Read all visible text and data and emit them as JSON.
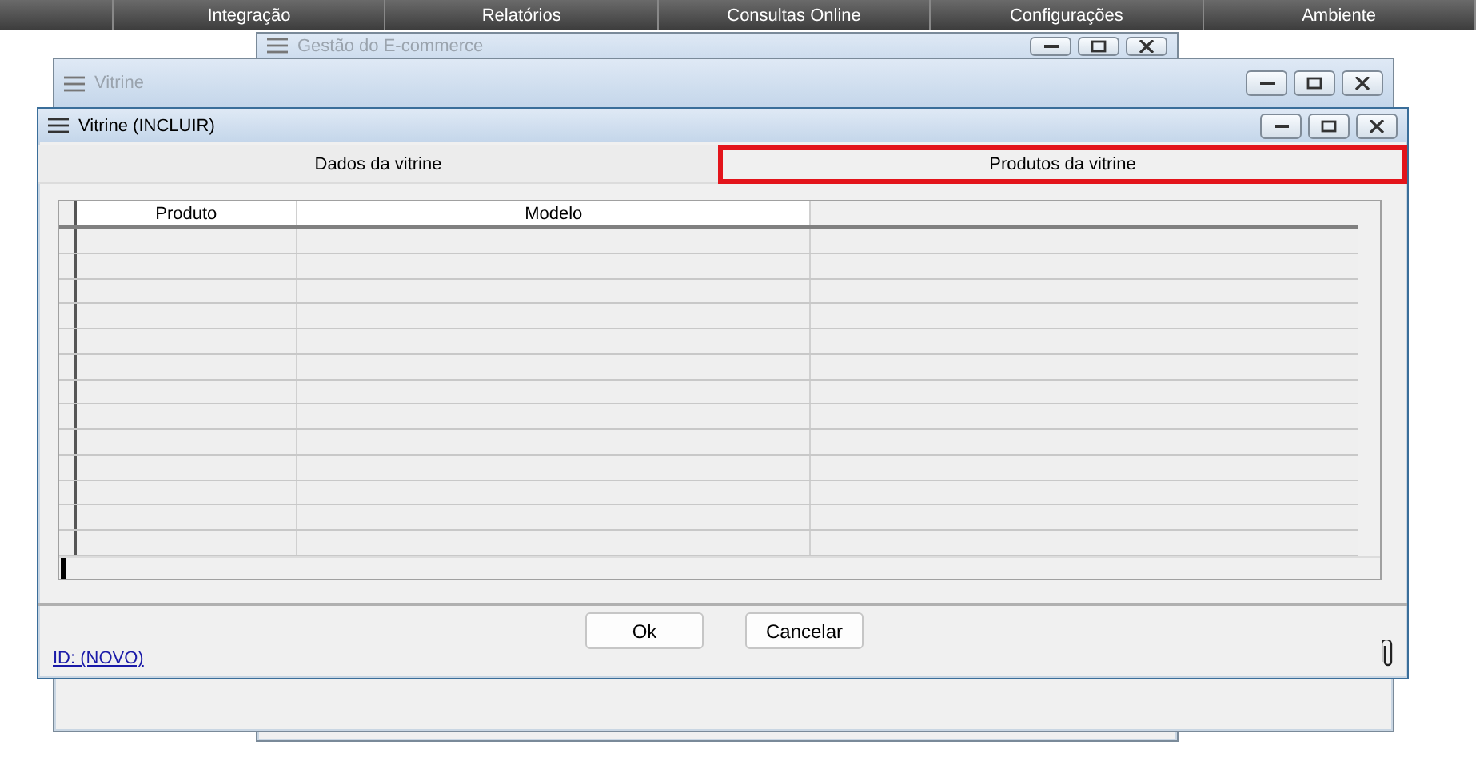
{
  "menu": [
    {
      "label": "Integração"
    },
    {
      "label": "Relatórios"
    },
    {
      "label": "Consultas Online"
    },
    {
      "label": "Configurações"
    },
    {
      "label": "Ambiente"
    }
  ],
  "windows": [
    {
      "title": "Gestão do E-commerce",
      "active": false
    },
    {
      "title": "Vitrine",
      "active": false
    }
  ],
  "dialog": {
    "title": "Vitrine (INCLUIR)",
    "tabs": [
      {
        "label": "Dados da vitrine",
        "selected": false
      },
      {
        "label": "Produtos da vitrine",
        "selected": true
      }
    ],
    "table": {
      "columns": [
        "Produto",
        "Modelo"
      ]
    },
    "id_link": "ID: (NOVO)",
    "buttons": [
      {
        "label": "Ok"
      },
      {
        "label": "Cancelar"
      }
    ]
  }
}
